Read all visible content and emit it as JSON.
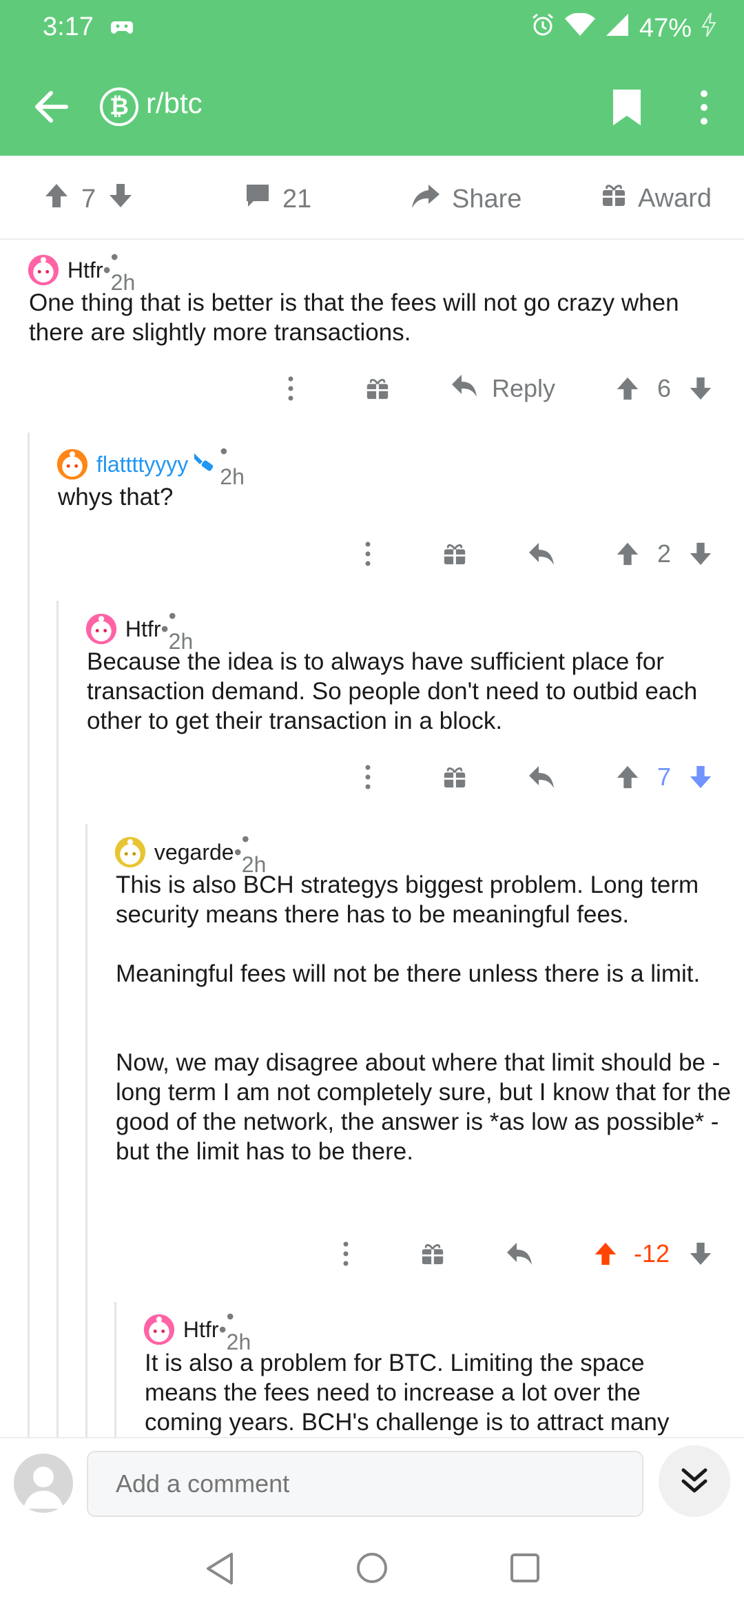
{
  "status_bar": {
    "time": "3:17",
    "battery": "47%"
  },
  "header": {
    "subreddit": "r/btc",
    "sub_icon_glyph": "₿"
  },
  "post_actions": {
    "upvotes": "7",
    "comments": "21",
    "share": "Share",
    "award": "Award"
  },
  "comments": [
    {
      "user": "Htfr",
      "sep": " • ",
      "time": "• 2h",
      "body": "One thing that is better is that the fees will not go crazy when there are slightly more transactions.",
      "reply": "Reply",
      "score": "6",
      "vote_state": "none"
    },
    {
      "user": "flattttyyyy",
      "sep": " ",
      "time": "• 2h",
      "body": "whys that?",
      "score": "2",
      "vote_state": "none"
    },
    {
      "user": "Htfr",
      "sep": " • ",
      "time": "• 2h",
      "body": "Because the idea is to always have sufficient place for transaction demand. So people don't need to outbid each other to get their transaction in a block.",
      "score": "7",
      "vote_state": "down"
    },
    {
      "user": "vegarde",
      "sep": " • ",
      "time": "• 2h",
      "body": "This is also BCH strategys biggest problem. Long term security means there has to be meaningful fees.\n\nMeaningful fees will not be there unless there is a limit.\n\n\nNow, we may disagree about where that limit should be - long term I am not completely sure, but I know that for the good of the network, the answer is *as low as possible* - but the limit has to be there.",
      "score": "-12",
      "vote_state": "up"
    },
    {
      "user": "Htfr",
      "sep": " • ",
      "time": "• 2h",
      "body": "It is also a problem for BTC. Limiting the space means the fees need to increase a lot over the coming years. BCH's challenge is to attract many"
    }
  ],
  "comment_bar": {
    "placeholder": "Add a comment"
  },
  "colors": {
    "header_green": "#5fcb7a",
    "upvote_orange": "#ff4500",
    "downvote_blue": "#7193ff",
    "flair_blue": "#2196f3"
  }
}
